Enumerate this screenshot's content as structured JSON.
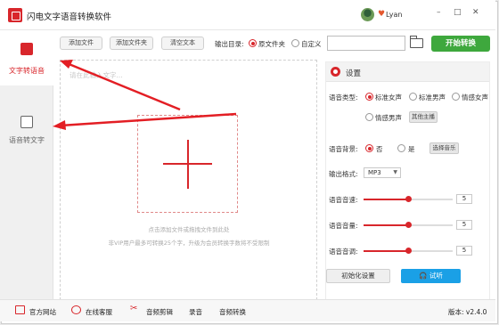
{
  "app": {
    "title": "闪电文字语音转换软件",
    "username": "Lyan",
    "win_min": "–",
    "win_max": "□",
    "win_close": "✕"
  },
  "sidebar": {
    "items": [
      {
        "label": "文字转语音",
        "active": true
      },
      {
        "label": "语音转文字",
        "active": false
      }
    ]
  },
  "toolbar": {
    "add_file": "添加文件",
    "add_folder": "添加文件夹",
    "clear_text": "清空文本",
    "output_dir_label": "输出目录:",
    "opt_source": "原文件夹",
    "opt_custom": "自定义",
    "path_value": "",
    "start": "开始转换"
  },
  "dropzone": {
    "placeholder": "请在此输入文字...",
    "hint1": "点击添加文件或拖拽文件到此处",
    "hint2": "非VIP用户最多可转换25个字，升级为会员转换字数将不受限制"
  },
  "settings": {
    "title": "设置",
    "voice_type_label": "语音类型:",
    "voices": [
      "标准女声",
      "标准男声",
      "情感女声",
      "情感男声"
    ],
    "other_anchor": "其他主播",
    "bg_label": "语音背景:",
    "bg_no": "否",
    "bg_yes": "是",
    "choose_music": "选择音乐",
    "format_label": "输出格式:",
    "format_value": "MP3",
    "speed_label": "语音音速:",
    "speed_value": "5",
    "volume_label": "语音音量:",
    "volume_value": "5",
    "pitch_label": "语音音调:",
    "pitch_value": "5",
    "reset": "初始化设置",
    "listen": "试听"
  },
  "footer": {
    "website": "官方网站",
    "support": "在线客服",
    "audio_cut": "音频剪辑",
    "record": "录音",
    "audio_convert": "音频转换",
    "version_label": "版本:",
    "version": "v2.4.0"
  },
  "colors": {
    "accent": "#d8262b",
    "start_green": "#3ea83d",
    "listen_blue": "#1aa0e6"
  }
}
